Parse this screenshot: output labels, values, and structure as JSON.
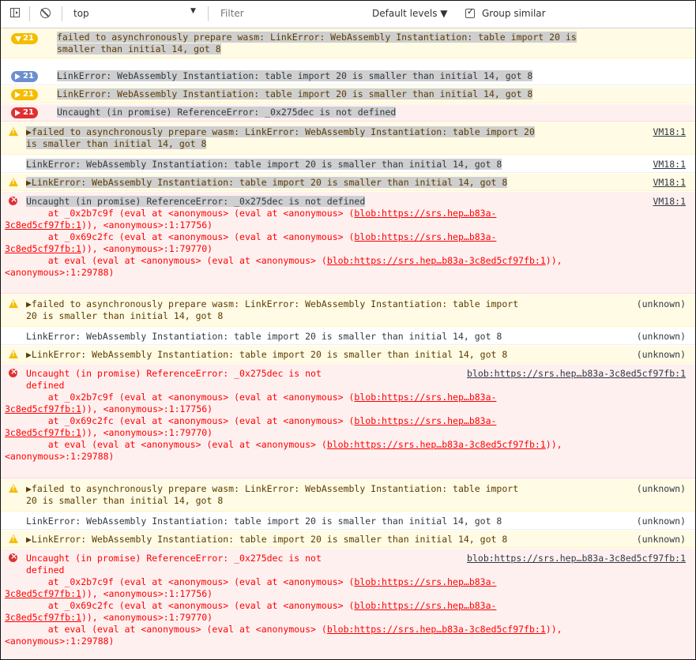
{
  "toolbar": {
    "context": "top",
    "filter_placeholder": "Filter",
    "levels_label": "Default levels ▼",
    "group_similar_label": "Group similar"
  },
  "groups": [
    {
      "count": "21",
      "text": "failed to asynchronously prepare wasm: LinkError: WebAssembly Instantiation: table import 20 is",
      "text2": "smaller than initial 14, got 8"
    },
    {
      "count": "21",
      "text": "LinkError: WebAssembly Instantiation: table import 20 is smaller than initial 14, got 8"
    },
    {
      "count": "21",
      "text": "LinkError: WebAssembly Instantiation: table import 20 is smaller than initial 14, got 8"
    },
    {
      "count": "21",
      "text": "Uncaught (in promise) ReferenceError: _0x275dec is not defined"
    }
  ],
  "block1": {
    "warn1": {
      "text": "▶failed to asynchronously prepare wasm: LinkError: WebAssembly Instantiation: table import 20",
      "text2": "is smaller than initial 14, got 8",
      "source": "VM18:1"
    },
    "info1": {
      "text": "LinkError: WebAssembly Instantiation: table import 20 is smaller than initial 14, got 8",
      "source": "VM18:1"
    },
    "warn2": {
      "text": "▶LinkError: WebAssembly Instantiation: table import 20 is smaller than initial 14, got 8",
      "source": "VM18:1"
    },
    "err": {
      "text": "Uncaught (in promise) ReferenceError: _0x275dec is not defined",
      "source": "VM18:1",
      "l1a": "    at _0x2b7c9f (eval at <anonymous> (eval at <anonymous> (",
      "l1link": "blob:https://srs.hep…b83a-",
      "l2link": "3c8ed5cf97fb:1",
      "l2b": ")), <anonymous>:1:17756)",
      "l3a": "    at _0x69c2fc (eval at <anonymous> (eval at <anonymous> (",
      "l3link": "blob:https://srs.hep…b83a-",
      "l4link": "3c8ed5cf97fb:1",
      "l4b": ")), <anonymous>:1:79770)",
      "l5a": "    at eval (eval at <anonymous> (eval at <anonymous> (",
      "l5link": "blob:https://srs.hep…b83a-3c8ed5cf97fb:1",
      "l5b": ")),",
      "l6": "<anonymous>:1:29788)"
    }
  },
  "block2": {
    "warn1": {
      "text": "▶failed to asynchronously prepare wasm: LinkError: WebAssembly Instantiation: table import",
      "text2": "20 is smaller than initial 14, got 8",
      "source": "(unknown)"
    },
    "info1": {
      "text": "LinkError: WebAssembly Instantiation: table import 20 is smaller than initial 14, got 8",
      "source": "(unknown)"
    },
    "warn2": {
      "text": "▶LinkError: WebAssembly Instantiation: table import 20 is smaller than initial 14, got 8",
      "source": "(unknown)"
    },
    "err": {
      "text": "Uncaught (in promise) ReferenceError: _0x275dec is not",
      "text2": "defined",
      "source": "blob:https://srs.hep…b83a-3c8ed5cf97fb:1",
      "l1a": "    at _0x2b7c9f (eval at <anonymous> (eval at <anonymous> (",
      "l1link": "blob:https://srs.hep…b83a-",
      "l2link": "3c8ed5cf97fb:1",
      "l2b": ")), <anonymous>:1:17756)",
      "l3a": "    at _0x69c2fc (eval at <anonymous> (eval at <anonymous> (",
      "l3link": "blob:https://srs.hep…b83a-",
      "l4link": "3c8ed5cf97fb:1",
      "l4b": ")), <anonymous>:1:79770)",
      "l5a": "    at eval (eval at <anonymous> (eval at <anonymous> (",
      "l5link": "blob:https://srs.hep…b83a-3c8ed5cf97fb:1",
      "l5b": ")),",
      "l6": "<anonymous>:1:29788)"
    }
  },
  "block3": {
    "warn1": {
      "text": "▶failed to asynchronously prepare wasm: LinkError: WebAssembly Instantiation: table import",
      "text2": "20 is smaller than initial 14, got 8",
      "source": "(unknown)"
    },
    "info1": {
      "text": "LinkError: WebAssembly Instantiation: table import 20 is smaller than initial 14, got 8",
      "source": "(unknown)"
    },
    "warn2": {
      "text": "▶LinkError: WebAssembly Instantiation: table import 20 is smaller than initial 14, got 8",
      "source": "(unknown)"
    },
    "err": {
      "text": "Uncaught (in promise) ReferenceError: _0x275dec is not",
      "text2": "defined",
      "source": "blob:https://srs.hep…b83a-3c8ed5cf97fb:1",
      "l1a": "    at _0x2b7c9f (eval at <anonymous> (eval at <anonymous> (",
      "l1link": "blob:https://srs.hep…b83a-",
      "l2link": "3c8ed5cf97fb:1",
      "l2b": ")), <anonymous>:1:17756)",
      "l3a": "    at _0x69c2fc (eval at <anonymous> (eval at <anonymous> (",
      "l3link": "blob:https://srs.hep…b83a-",
      "l4link": "3c8ed5cf97fb:1",
      "l4b": ")), <anonymous>:1:79770)",
      "l5a": "    at eval (eval at <anonymous> (eval at <anonymous> (",
      "l5link": "blob:https://srs.hep…b83a-3c8ed5cf97fb:1",
      "l5b": ")),",
      "l6": "<anonymous>:1:29788)"
    }
  }
}
